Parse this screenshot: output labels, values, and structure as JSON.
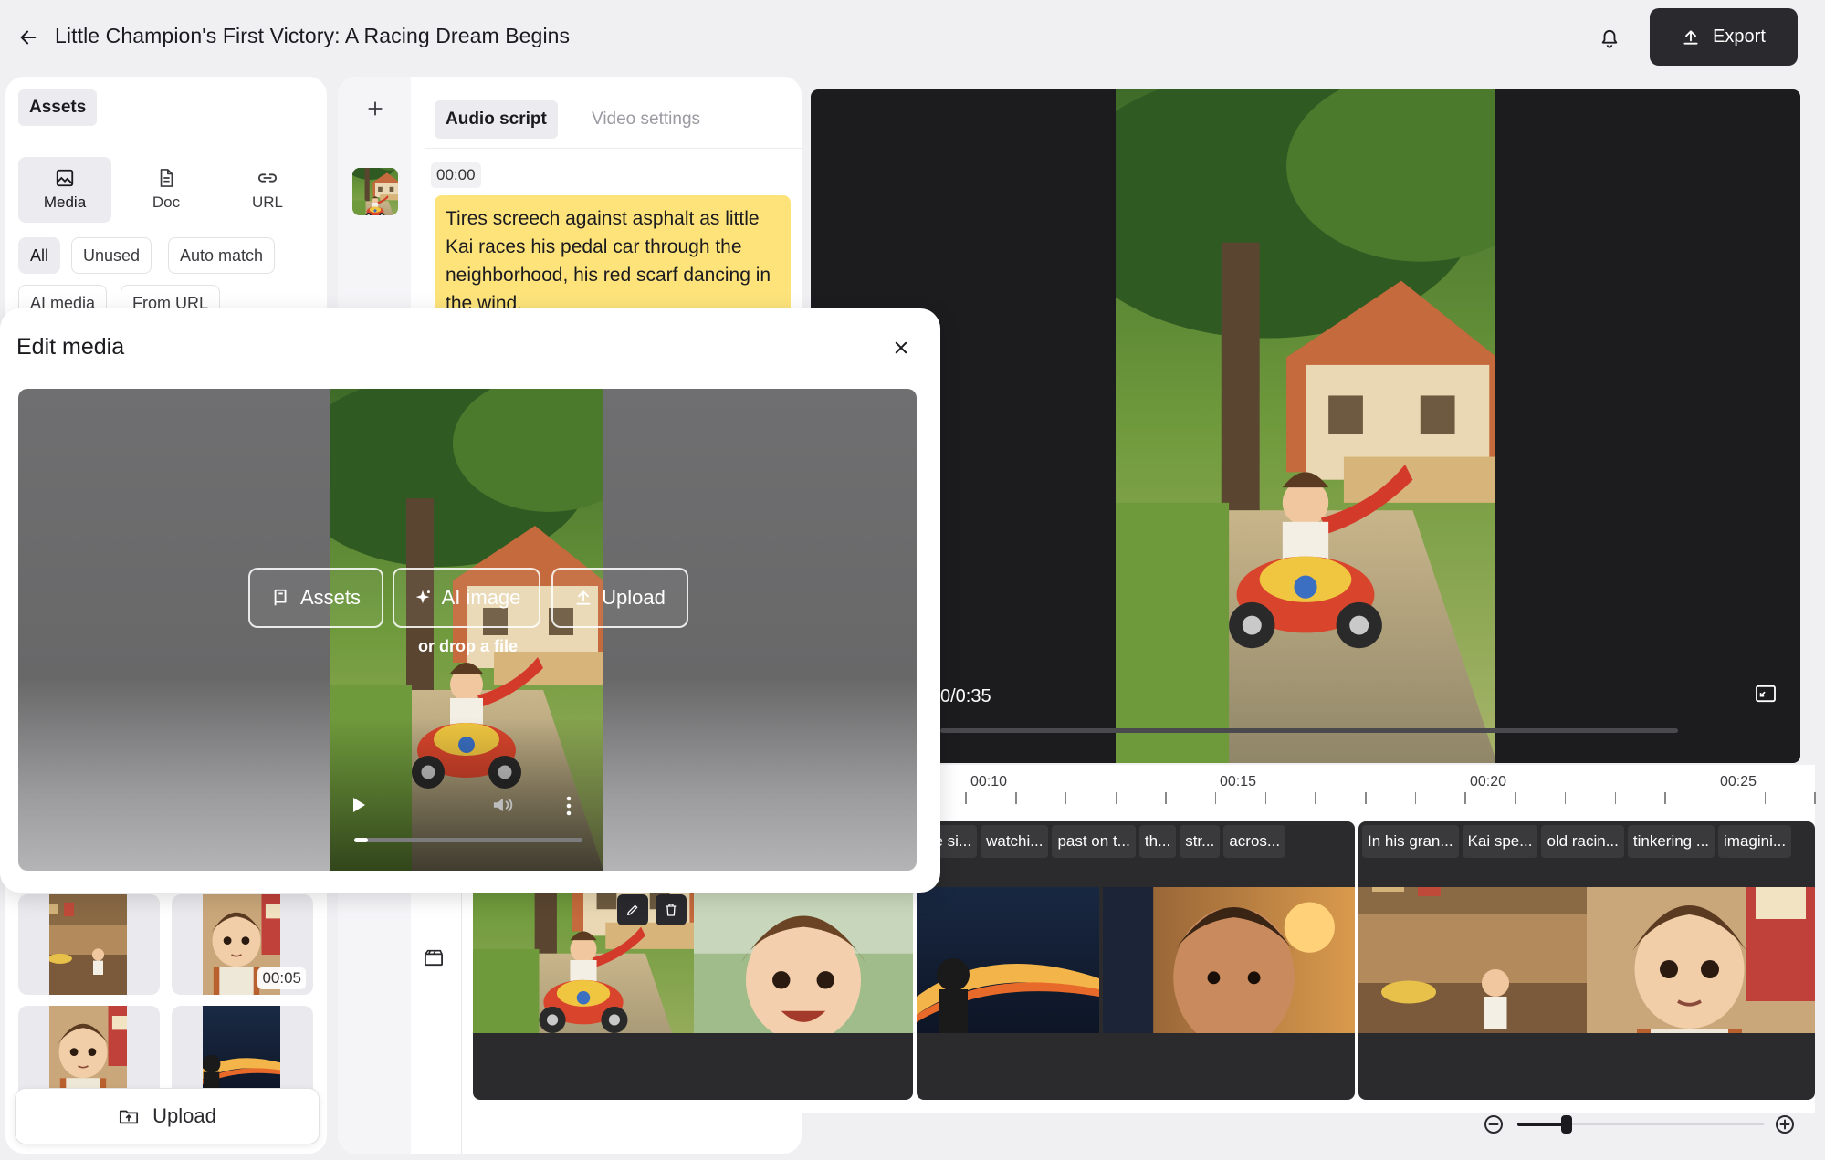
{
  "header": {
    "title": "Little Champion's First Victory: A Racing Dream Begins",
    "back_icon": "arrow-left-icon",
    "bell_icon": "bell-icon",
    "export_label": "Export"
  },
  "assets_panel": {
    "tab_label": "Assets",
    "source_tabs": [
      {
        "label": "Media",
        "icon": "image-icon",
        "active": true
      },
      {
        "label": "Doc",
        "icon": "document-icon",
        "active": false
      },
      {
        "label": "URL",
        "icon": "link-icon",
        "active": false
      }
    ],
    "filters": [
      "All",
      "Unused",
      "Auto match",
      "AI media",
      "From URL"
    ],
    "active_filter": "All",
    "thumb_duration": "00:05",
    "upload_label": "Upload"
  },
  "script_panel": {
    "tabs": [
      "Audio script",
      "Video settings"
    ],
    "active_tab": "Audio script",
    "scene": {
      "time": "00:00",
      "text": "Tires screech against asphalt as little Kai races his pedal car through the neighborhood, his red scarf dancing in the wind."
    }
  },
  "preview": {
    "time_display": "0/0:35"
  },
  "timeline": {
    "ruler": [
      "00:10",
      "00:15",
      "00:20",
      "00:25"
    ],
    "clips": [
      {
        "labels": []
      },
      {
        "labels": [
          "he si...",
          "watchi...",
          "past on t...",
          "th...",
          "str...",
          "acros..."
        ]
      },
      {
        "labels": [
          "In his gran...",
          "Kai spe...",
          "old racin...",
          "tinkering ...",
          "imagini..."
        ]
      }
    ],
    "zoom_level": 0.2
  },
  "edit_media": {
    "title": "Edit media",
    "buttons": [
      "Assets",
      "AI image",
      "Upload"
    ],
    "drop_text": "or drop a file",
    "video_progress": 0.06
  },
  "colors": {
    "accent_dark": "#2a2a2e",
    "script_highlight": "#fde37a",
    "panel_bg": "#ffffff",
    "app_bg": "#f0f0f3"
  }
}
